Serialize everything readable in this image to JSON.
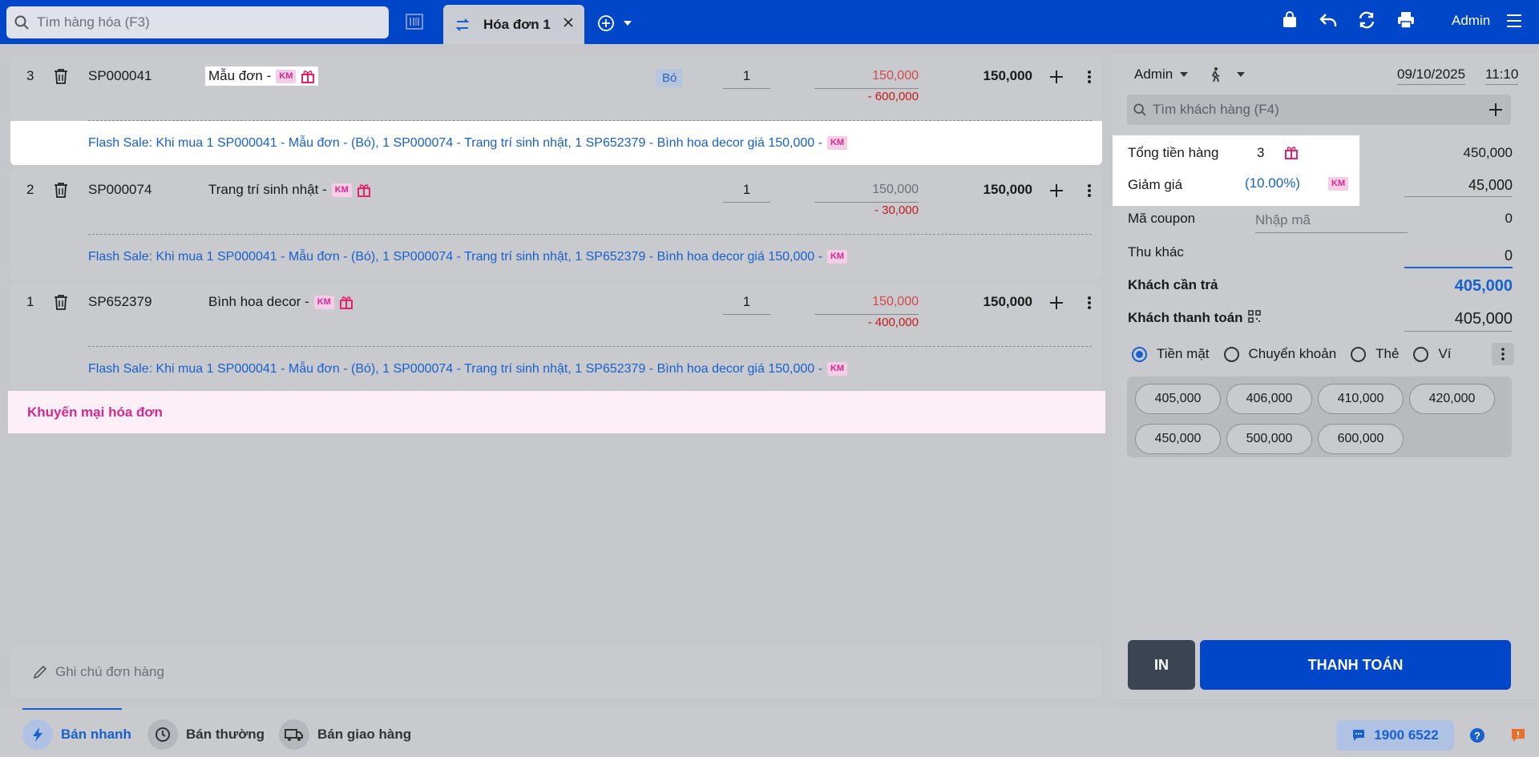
{
  "topbar": {
    "search_placeholder": "Tìm hàng hóa (F3)",
    "tab_title": "Hóa đơn 1",
    "user": "Admin"
  },
  "cart": {
    "items": [
      {
        "index": "3",
        "code": "SP000041",
        "name": "Mẫu đơn -",
        "km": "KM",
        "unit": "Bó",
        "qty": "1",
        "price": "150,000",
        "discount": "- 600,000",
        "total": "150,000",
        "flash": "Flash Sale: Khi mua 1 SP000041 - Mẫu đơn - (Bó), 1 SP000074 - Trang trí sinh nhật, 1 SP652379 - Bình hoa decor giá 150,000 -",
        "flash_km": "KM"
      },
      {
        "index": "2",
        "code": "SP000074",
        "name": "Trang trí sinh nhật -",
        "km": "KM",
        "qty": "1",
        "price": "150,000",
        "discount": "- 30,000",
        "total": "150,000",
        "flash": "Flash Sale: Khi mua 1 SP000041 - Mẫu đơn - (Bó), 1 SP000074 - Trang trí sinh nhật, 1 SP652379 - Bình hoa decor giá 150,000 -",
        "flash_km": "KM"
      },
      {
        "index": "1",
        "code": "SP652379",
        "name": "Bình hoa decor -",
        "km": "KM",
        "qty": "1",
        "price": "150,000",
        "discount": "- 400,000",
        "total": "150,000",
        "flash": "Flash Sale: Khi mua 1 SP000041 - Mẫu đơn - (Bó), 1 SP000074 - Trang trí sinh nhật, 1 SP652379 - Bình hoa decor giá 150,000 -",
        "flash_km": "KM"
      }
    ],
    "invoice_promo": "Khuyến mại hóa đơn",
    "note_placeholder": "Ghi chú đơn hàng"
  },
  "checkout": {
    "seller": "Admin",
    "date": "09/10/2025",
    "time": "11:10",
    "customer_placeholder": "Tìm khách hàng (F4)",
    "subtotal_label": "Tổng tiền hàng",
    "subtotal_count": "3",
    "subtotal_value": "450,000",
    "discount_label": "Giảm giá",
    "discount_pct": "(10.00%)",
    "discount_km": "KM",
    "discount_value": "45,000",
    "coupon_label": "Mã coupon",
    "coupon_placeholder": "Nhập mã",
    "coupon_value": "0",
    "other_label": "Thu khác",
    "other_value": "0",
    "due_label": "Khách cần trả",
    "due_value": "405,000",
    "paid_label": "Khách thanh toán",
    "paid_value": "405,000",
    "methods": [
      "Tiền mặt",
      "Chuyển khoản",
      "Thẻ",
      "Ví"
    ],
    "amounts": [
      "405,000",
      "406,000",
      "410,000",
      "420,000",
      "450,000",
      "500,000",
      "600,000"
    ],
    "print_label": "IN",
    "pay_label": "THANH TOÁN"
  },
  "bottombar": {
    "modes": [
      "Bán nhanh",
      "Bán thường",
      "Bán giao hàng"
    ],
    "hotline": "1900 6522"
  },
  "colors": {
    "brand": "#0046c8",
    "promo": "#d42a8c",
    "link": "#1760d0",
    "discount": "#c51a1a"
  }
}
